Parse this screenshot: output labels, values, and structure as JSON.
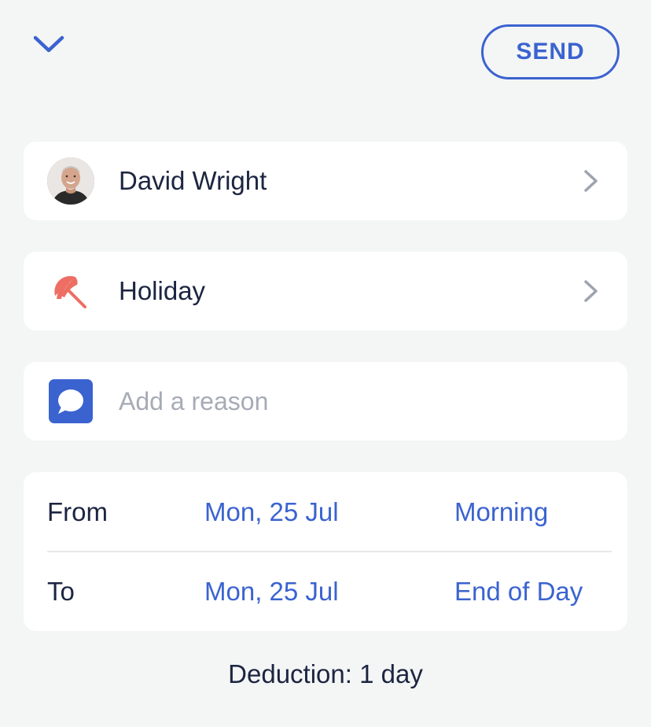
{
  "header": {
    "collapse_icon": "chevron-down-icon",
    "send_label": "SEND"
  },
  "employee": {
    "name": "David Wright",
    "icon": "avatar"
  },
  "leave_type": {
    "label": "Holiday",
    "icon": "beach-umbrella-icon"
  },
  "reason": {
    "placeholder": "Add a reason",
    "value": "",
    "icon": "speech-bubble-icon"
  },
  "dates": {
    "from": {
      "label": "From",
      "date": "Mon, 25 Jul",
      "time": "Morning"
    },
    "to": {
      "label": "To",
      "date": "Mon, 25 Jul",
      "time": "End of Day"
    }
  },
  "deduction": "Deduction: 1 day",
  "colors": {
    "accent": "#3b63d0",
    "umbrella": "#ee6e63",
    "background": "#f4f5f5",
    "text": "#1c2541",
    "placeholder": "#a7abb6"
  }
}
